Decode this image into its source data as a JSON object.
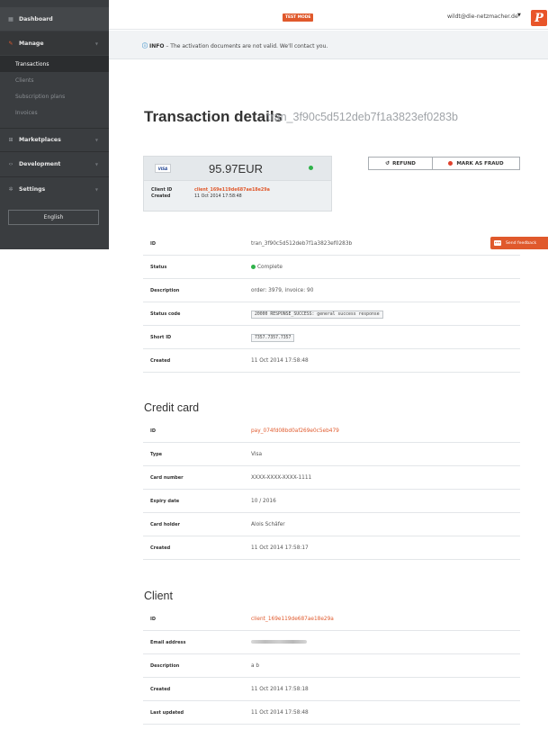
{
  "sidebar": {
    "dashboard": "Dashboard",
    "manage": "Manage",
    "sub_items": [
      "Transactions",
      "Clients",
      "Subscription plans",
      "Invoices"
    ],
    "marketplaces": "Marketplaces",
    "development": "Development",
    "settings": "Settings",
    "language": "English"
  },
  "topbar": {
    "test_mode": "TEST MODE",
    "user_email": "wildt@die-netzmacher.de",
    "logo": "P"
  },
  "info": {
    "label": "INFO",
    "message": "– The activation documents are not valid. We'll contact you."
  },
  "title": {
    "main": "Transaction details",
    "id": "tran_3f90c5d512deb7f1a3823ef0283b"
  },
  "summary": {
    "card_brand": "VISA",
    "amount": "95.97EUR",
    "client_id_label": "Client ID",
    "client_id": "client_169e119de687ae18e29a",
    "created_label": "Created",
    "created": "11 Oct 2014 17:58:48"
  },
  "actions": {
    "refund": "REFUND",
    "fraud": "MARK AS FRAUD"
  },
  "feedback": "Send feedback",
  "transaction": [
    {
      "label": "ID",
      "value": "tran_3f90c5d512deb7f1a3823ef0283b"
    },
    {
      "label": "Status",
      "value": "Complete"
    },
    {
      "label": "Description",
      "value": "order: 3979, invoice: 90"
    },
    {
      "label": "Status code",
      "value": "20000 RESPONSE_SUCCESS: general success response"
    },
    {
      "label": "Short ID",
      "value": "7357.7357.7357"
    },
    {
      "label": "Created",
      "value": "11 Oct 2014 17:58:48"
    }
  ],
  "credit_card": {
    "title": "Credit card",
    "rows": [
      {
        "label": "ID",
        "value": "pay_074fd08bd0af269e0c5eb479"
      },
      {
        "label": "Type",
        "value": "Visa"
      },
      {
        "label": "Card number",
        "value": "XXXX-XXXX-XXXX-1111"
      },
      {
        "label": "Expiry date",
        "value": "10 / 2016"
      },
      {
        "label": "Card holder",
        "value": "Alois Schäfer"
      },
      {
        "label": "Created",
        "value": "11 Oct 2014 17:58:17"
      }
    ]
  },
  "client": {
    "title": "Client",
    "rows": [
      {
        "label": "ID",
        "value": "client_169e119de687ae18e29a"
      },
      {
        "label": "Email address",
        "value": ""
      },
      {
        "label": "Description",
        "value": "a b"
      },
      {
        "label": "Created",
        "value": "11 Oct 2014 17:58:18"
      },
      {
        "label": "Last updated",
        "value": "11 Oct 2014 17:58:48"
      }
    ]
  },
  "colors": {
    "accent": "#e0592c",
    "success": "#2fb24a",
    "sidebar": "#3a3d40"
  }
}
